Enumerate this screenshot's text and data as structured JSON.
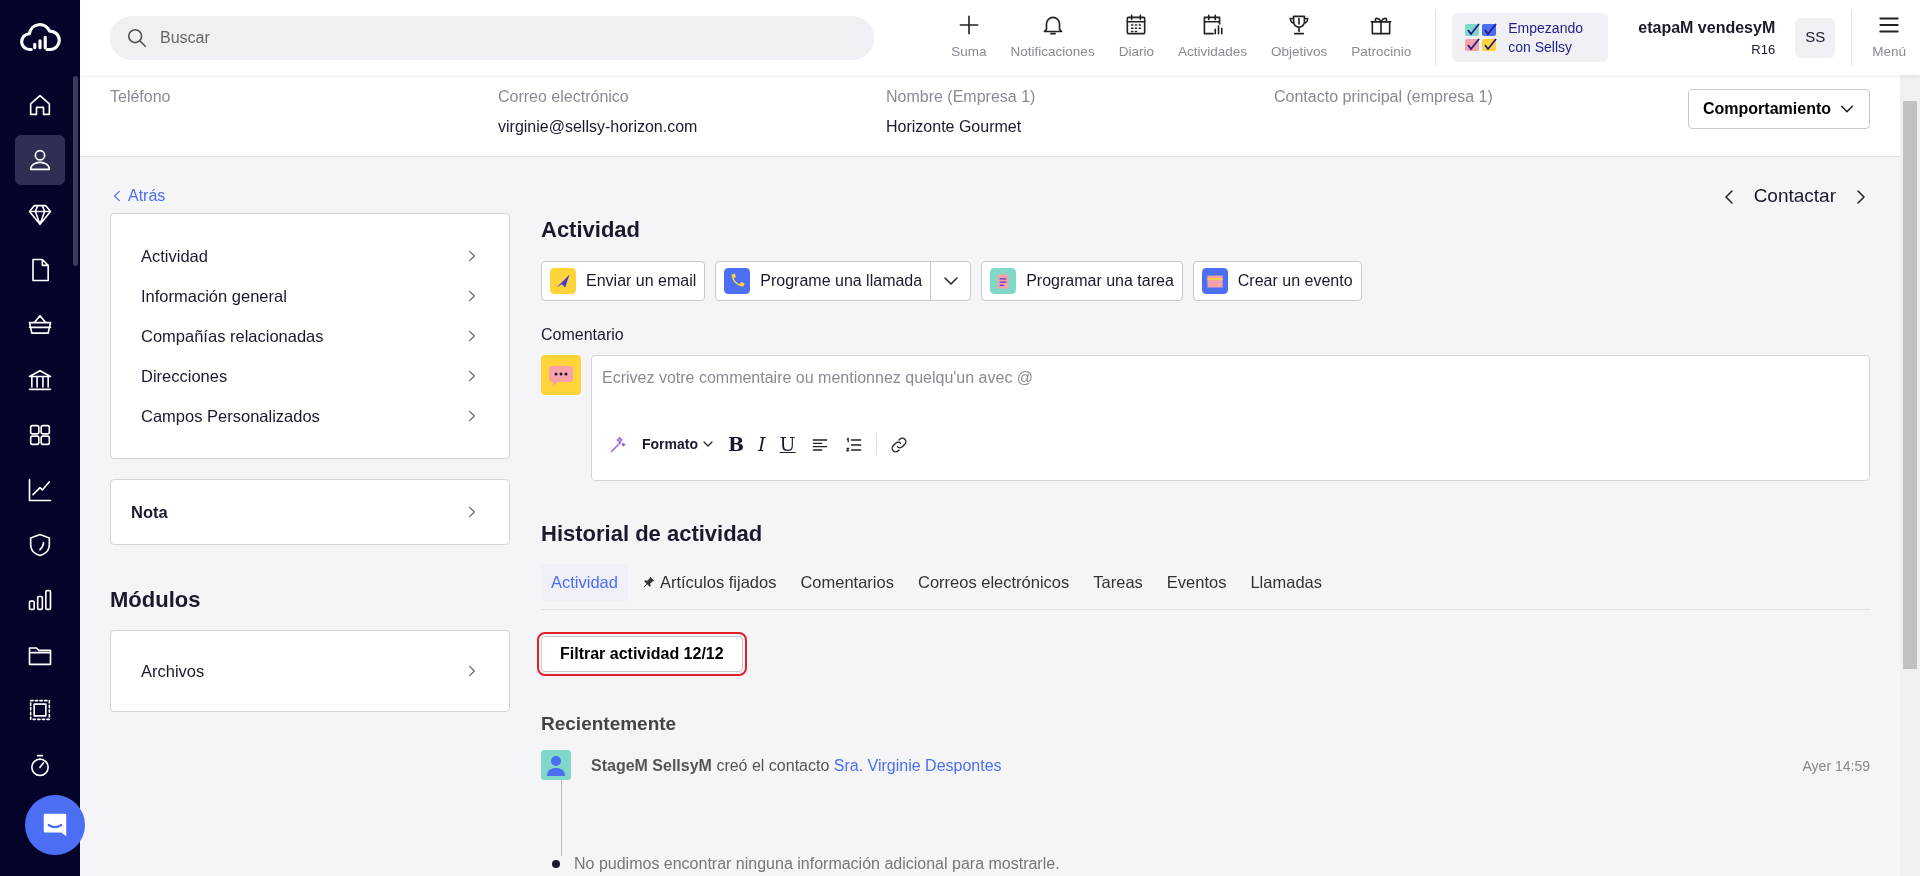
{
  "sidebar": {
    "items": [
      {
        "selected": false
      },
      {
        "selected": true
      },
      {
        "selected": false
      },
      {
        "selected": false
      },
      {
        "selected": false
      },
      {
        "selected": false
      },
      {
        "selected": false
      },
      {
        "selected": false
      },
      {
        "selected": false
      },
      {
        "selected": false
      },
      {
        "selected": false
      },
      {
        "selected": false
      },
      {
        "selected": false
      }
    ]
  },
  "topbar": {
    "search": {
      "placeholder": "Buscar"
    },
    "actions": [
      {
        "label": "Suma"
      },
      {
        "label": "Notificaciones"
      },
      {
        "label": "Diario"
      },
      {
        "label": "Actividades"
      },
      {
        "label": "Objetivos"
      },
      {
        "label": "Patrocinio"
      }
    ],
    "onboarding": "Empezando con Sellsy",
    "user": {
      "name": "etapaM vendesyM",
      "subtitle": "R16",
      "initials": "SS"
    },
    "menu": "Menú"
  },
  "contact_fields": [
    {
      "label": "Teléfono"
    },
    {
      "label": "Correo electrónico",
      "value": "virginie@sellsy-horizon.com"
    },
    {
      "label": "Nombre (Empresa 1)",
      "value": "Horizonte Gourmet"
    },
    {
      "label": "Contacto principal (empresa 1)"
    }
  ],
  "behaviour_button": "Comportamiento",
  "back_link": "Atrás",
  "pager_label": "Contactar",
  "sections_menu": [
    "Actividad",
    "Información general",
    "Compañías relacionadas",
    "Direcciones",
    "Campos Personalizados"
  ],
  "note_card": "Nota",
  "modules": {
    "title": "Módulos",
    "items": [
      "Archivos"
    ]
  },
  "activity": {
    "title": "Actividad",
    "buttons": [
      {
        "label": "Enviar un email",
        "kind": "email",
        "dropdown": false
      },
      {
        "label": "Programe una llamada",
        "kind": "call",
        "dropdown": true
      },
      {
        "label": "Programar una tarea",
        "kind": "task",
        "dropdown": false
      },
      {
        "label": "Crear un evento",
        "kind": "event",
        "dropdown": false
      }
    ],
    "comment_label": "Comentario",
    "comment_placeholder": "Ecrivez votre commentaire ou mentionnez quelqu'un avec @",
    "toolbar": {
      "format_label": "Formato",
      "buttons": [
        {
          "kind": "bold",
          "label": "B"
        },
        {
          "kind": "italic",
          "label": "I"
        },
        {
          "kind": "underline",
          "label": "U"
        },
        {
          "kind": "align"
        },
        {
          "kind": "list"
        },
        {
          "kind": "link"
        }
      ]
    }
  },
  "history": {
    "title": "Historial de actividad",
    "tabs": [
      {
        "label": "Actividad",
        "kind": "plain",
        "selected": true
      },
      {
        "label": "Artículos fijados",
        "kind": "pinned",
        "selected": false
      },
      {
        "label": "Comentarios",
        "kind": "plain",
        "selected": false
      },
      {
        "label": "Correos electrónicos",
        "kind": "plain",
        "selected": false
      },
      {
        "label": "Tareas",
        "kind": "plain",
        "selected": false
      },
      {
        "label": "Eventos",
        "kind": "plain",
        "selected": false
      },
      {
        "label": "Llamadas",
        "kind": "plain",
        "selected": false
      }
    ],
    "filter_button": {
      "label": "Filtrar actividad 12/12",
      "focused": true
    },
    "group_title": "Recientemente",
    "entries": [
      {
        "text": "**StageM SellsyM** creó el contacto",
        "link": "Sra. Virginie Despontes",
        "time": "Ayer 14:59"
      }
    ],
    "empty_note": "No pudimos encontrar ninguna información adicional para mostrarle."
  }
}
